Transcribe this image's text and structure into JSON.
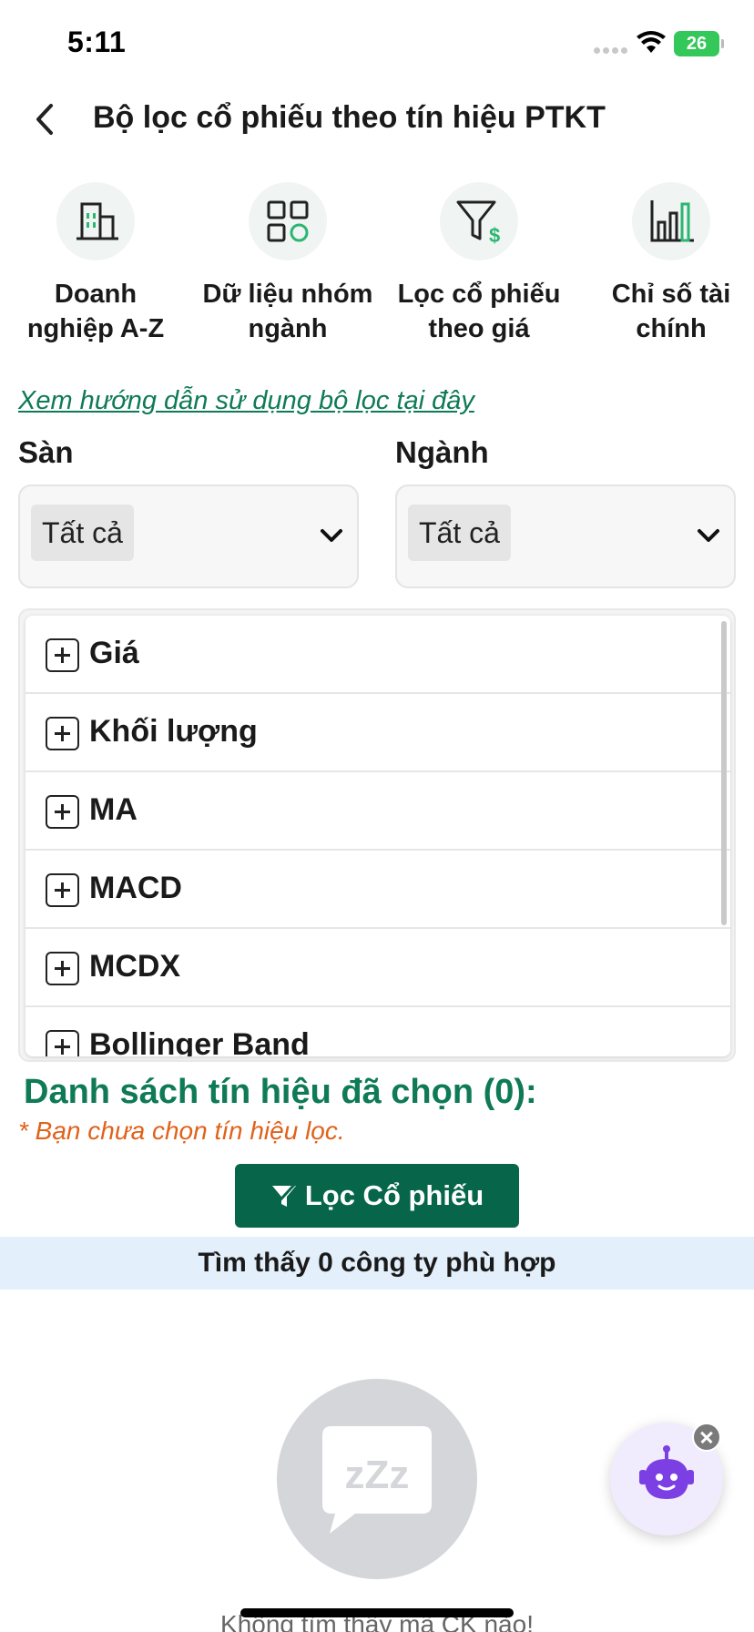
{
  "status_bar": {
    "time": "5:11",
    "battery": "26"
  },
  "header": {
    "title": "Bộ lọc cổ phiếu theo tín hiệu PTKT"
  },
  "quick_menu": [
    {
      "line1": "Doanh",
      "line2": "nghiệp A-Z",
      "icon": "building-icon"
    },
    {
      "line1": "Dữ liệu nhóm",
      "line2": "ngành",
      "icon": "grid-icon"
    },
    {
      "line1": "Lọc cổ phiếu",
      "line2": "theo giá",
      "icon": "filter-dollar-icon"
    },
    {
      "line1": "Chỉ số tài",
      "line2": "chính",
      "icon": "bar-chart-icon"
    }
  ],
  "guide_link": "Xem hướng dẫn sử dụng bộ lọc tại đây",
  "filters": {
    "exchange_label": "Sàn",
    "exchange_value": "Tất cả",
    "industry_label": "Ngành",
    "industry_value": "Tất cả"
  },
  "signals": [
    "Giá",
    "Khối lượng",
    "MA",
    "MACD",
    "MCDX",
    "Bollinger Band"
  ],
  "selected": {
    "title": "Danh sách tín hiệu đã chọn (0):",
    "note": "* Bạn chưa chọn tín hiệu lọc."
  },
  "filter_button": "Lọc Cổ phiếu",
  "result_text": "Tìm thấy 0 công ty phù hợp",
  "empty_state": {
    "text": "Không tìm thấy mã CK nào!"
  },
  "colors": {
    "brand_green": "#07664a",
    "link_green": "#0f7a56",
    "warning_orange": "#e0621b",
    "result_bg": "#e3effa"
  }
}
